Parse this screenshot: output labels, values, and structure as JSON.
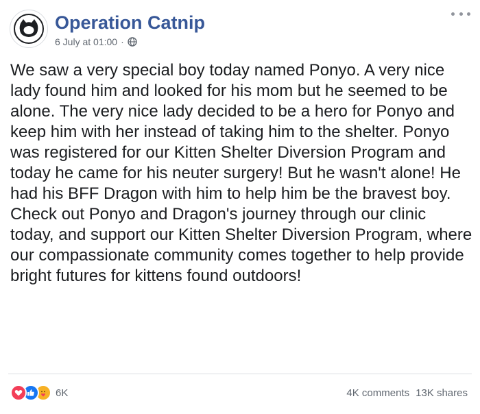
{
  "post": {
    "page_name": "Operation Catnip",
    "timestamp": "6 July at 01:00",
    "separator": "·",
    "audience_icon": "globe-icon",
    "more_icon": "more-options-icon",
    "avatar_icon": "cat-head-logo",
    "body": "We saw a very special boy today named Ponyo. A very nice lady found him and looked for his mom but he seemed to be alone. The very nice lady decided to be a hero for Ponyo and keep him with her instead of taking him to the shelter. Ponyo was registered for our Kitten Shelter Diversion Program and today he came for his neuter surgery! But he wasn't alone! He had his BFF Dragon with him to help him be the bravest boy. Check out Ponyo and Dragon's journey through our clinic today, and support our Kitten Shelter Diversion Program, where our compassionate community comes together to help provide bright futures for kittens found outdoors!"
  },
  "footer": {
    "reactions": [
      "love-reaction-icon",
      "like-reaction-icon",
      "care-reaction-icon"
    ],
    "reaction_count": "6K",
    "comments": "4K comments",
    "shares": "13K shares"
  },
  "colors": {
    "page_name": "#385898",
    "meta_text": "#606770",
    "love": "#f33e58",
    "like": "#1877f2",
    "care": "#f7b125",
    "divider": "#dadde1"
  }
}
